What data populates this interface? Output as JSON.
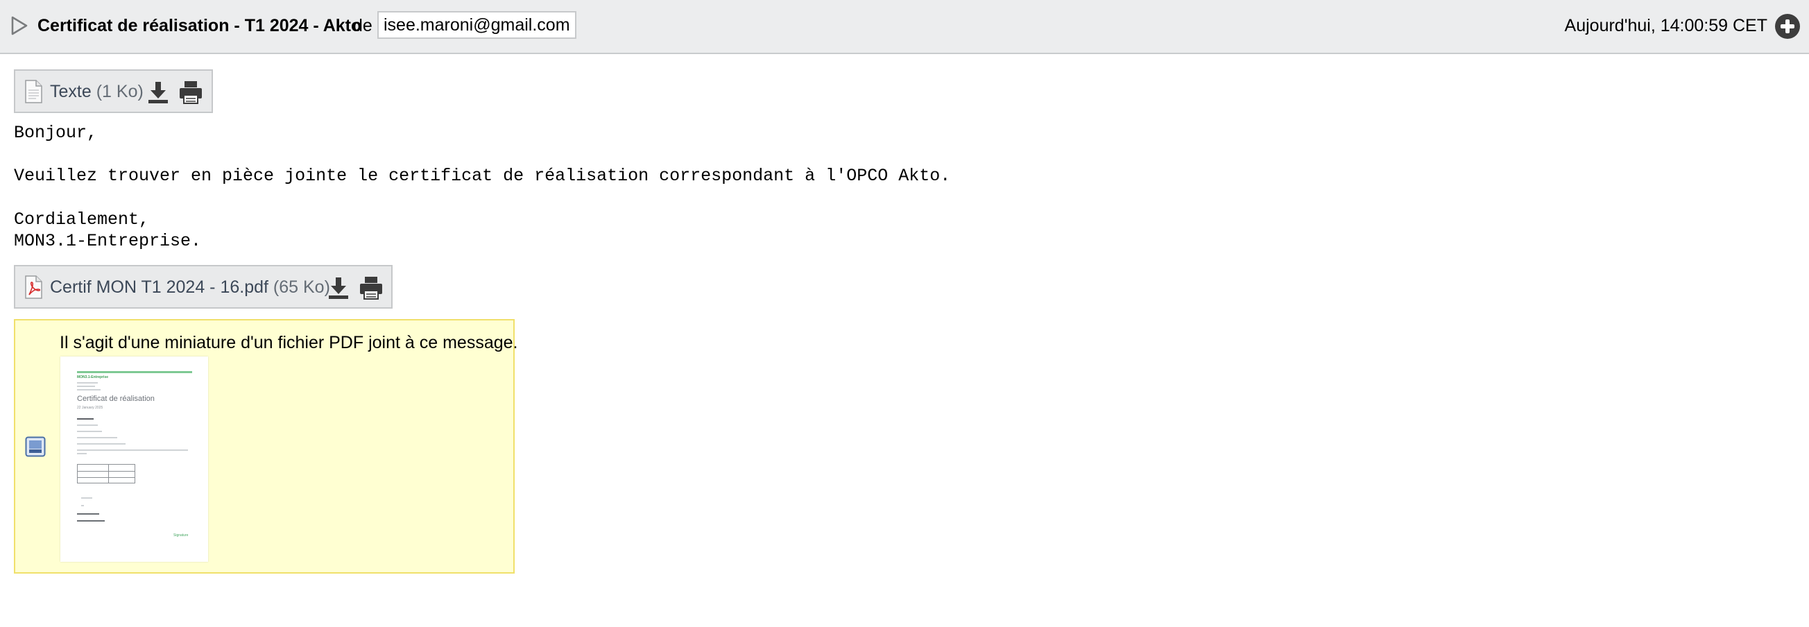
{
  "header": {
    "subject": "Certificat de réalisation - T1 2024 - Akto",
    "from_label": "de",
    "sender": "isee.maroni@gmail.com",
    "date": "Aujourd'hui, 14:00:59 CET",
    "disclosure_icon": "triangle-right-icon",
    "add_icon": "plus-circle-icon"
  },
  "attachments": [
    {
      "name": "Texte",
      "size": "(1 Ko)",
      "icon": "text-file-icon"
    },
    {
      "name": "Certif MON T1 2024 - 16.pdf",
      "size": "(65 Ko)",
      "icon": "pdf-file-icon"
    }
  ],
  "body": {
    "lines": [
      "Bonjour,",
      "",
      "Veuillez trouver en pièce jointe le certificat de réalisation correspondant à l'OPCO Akto.",
      "",
      "Cordialement,",
      "MON3.1-Entreprise."
    ]
  },
  "preview": {
    "note": "Il s'agit d'une miniature d'un fichier PDF joint à ce message.",
    "thumbnail": {
      "brand": "MON3.1-Entreprise",
      "title": "Certificat de réalisation",
      "subtitle": "22 January 2025",
      "signature": "Signature"
    }
  },
  "colors": {
    "header_bg": "#ecedee",
    "preview_bg": "#ffffd2",
    "preview_border": "#f0e06b",
    "pdf_icon": "#d62b2b"
  }
}
